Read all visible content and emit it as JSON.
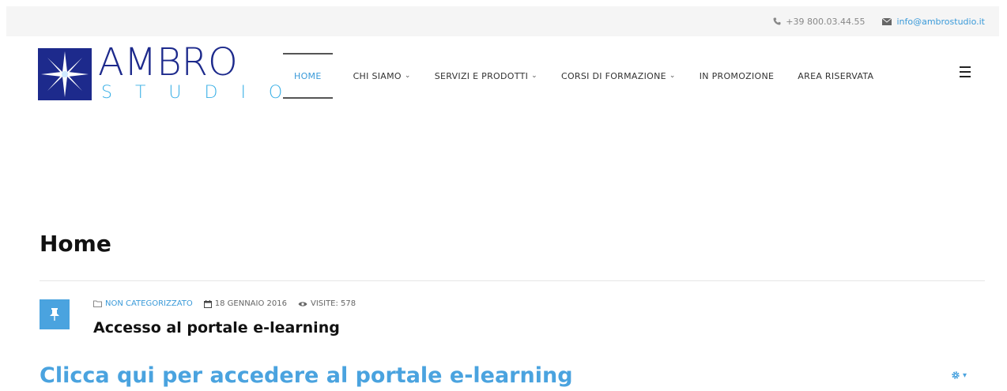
{
  "topbar": {
    "phone": "+39 800.03.44.55",
    "email": "info@ambrostudio.it"
  },
  "logo": {
    "name": "AMBRO",
    "tagline": "STUDIO"
  },
  "nav": {
    "items": [
      {
        "label": "HOME",
        "dropdown": false,
        "active": true
      },
      {
        "label": "CHI SIAMO",
        "dropdown": true
      },
      {
        "label": "SERVIZI E PRODOTTI",
        "dropdown": true
      },
      {
        "label": "CORSI DI FORMAZIONE",
        "dropdown": true
      },
      {
        "label": "IN PROMOZIONE",
        "dropdown": false
      },
      {
        "label": "AREA RISERVATA",
        "dropdown": false
      }
    ]
  },
  "page": {
    "title": "Home"
  },
  "post": {
    "category": "NON CATEGORIZZATO",
    "date": "18 GENNAIO 2016",
    "views": "VISITE: 578",
    "title": "Accesso al portale e-learning",
    "link_text": "Clicca qui per accedere al portale e-learning"
  },
  "colors": {
    "brand_dark": "#1d2a8c",
    "brand_light": "#3bb0e6",
    "accent": "#4aa3df"
  },
  "icons": {
    "phone": "phone-icon",
    "email": "envelope-icon",
    "category": "folder-icon",
    "date": "calendar-icon",
    "views": "eye-icon",
    "post_format": "pushpin-icon",
    "tools": "gear-icon",
    "menu": "hamburger-icon"
  }
}
